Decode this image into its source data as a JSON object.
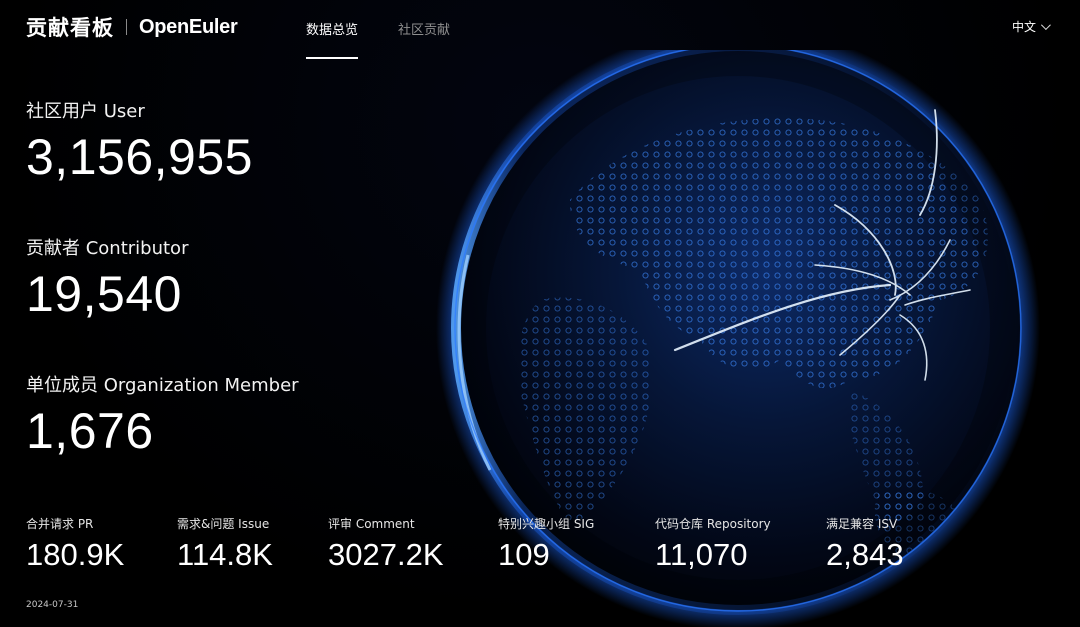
{
  "header": {
    "title": "贡献看板",
    "logo_text": "OpenEuler",
    "nav": [
      "数据总览",
      "社区贡献"
    ],
    "active_nav": 0,
    "language": "中文"
  },
  "big_stats": [
    {
      "label": "社区用户 User",
      "value": "3,156,955"
    },
    {
      "label": "贡献者 Contributor",
      "value": "19,540"
    },
    {
      "label": "单位成员 Organization Member",
      "value": "1,676"
    }
  ],
  "small_stats": [
    {
      "label": "合并请求 PR",
      "value": "180.9K"
    },
    {
      "label": "需求&问题 Issue",
      "value": "114.8K"
    },
    {
      "label": "评审 Comment",
      "value": "3027.2K"
    },
    {
      "label": "特别兴趣小组 SIG",
      "value": "109"
    },
    {
      "label": "代码仓库 Repository",
      "value": "11,070"
    },
    {
      "label": "满足兼容 ISV",
      "value": "2,843"
    }
  ],
  "date": "2024-07-31",
  "colors": {
    "background": "#000000",
    "globe_glow": "#1e6bff",
    "text": "#ffffff"
  }
}
